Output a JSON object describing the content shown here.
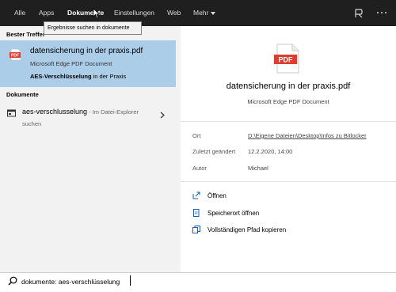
{
  "nav": {
    "tabs": [
      {
        "label": "Alle"
      },
      {
        "label": "Apps"
      },
      {
        "label": "Dokumente"
      },
      {
        "label": "Einstellungen"
      },
      {
        "label": "Web"
      },
      {
        "label": "Mehr"
      }
    ],
    "active_tab": "Dokumente",
    "icons": [
      "feedback-icon",
      "more-options-icon"
    ]
  },
  "tooltip": {
    "text": "Ergebnisse suchen in dokumente"
  },
  "left": {
    "best_match_label": "Bester Treffer",
    "best_match": {
      "title": "datensicherung in der praxis.pdf",
      "type": "Microsoft Edge PDF Document",
      "match_bold": "AES-Verschlüsselung",
      "match_rest": " in der Praxis",
      "icon": "pdf-icon"
    },
    "documents_label": "Dokumente",
    "documents": [
      {
        "title": "aes-verschlusselung",
        "hint": " - Im Datei-Explorer",
        "hint2": "suchen",
        "icon": "file-explorer-icon"
      }
    ]
  },
  "preview": {
    "title": "datensicherung in der praxis.pdf",
    "type": "Microsoft Edge PDF Document",
    "meta": [
      {
        "key": "Ort",
        "value": "D:\\Eigene Dateien\\Desktop\\Infos zu Bitlocker"
      },
      {
        "key": "Zuletzt geändert",
        "value": "12.2.2020, 14:00"
      },
      {
        "key": "Autor",
        "value": "Michael"
      }
    ],
    "actions": [
      {
        "label": "Öffnen",
        "icon": "open-icon"
      },
      {
        "label": "Speicherort öffnen",
        "icon": "folder-location-icon"
      },
      {
        "label": "Vollständigen Pfad kopieren",
        "icon": "copy-path-icon"
      }
    ]
  },
  "search": {
    "value": "dokumente: aes-verschlüsselung"
  },
  "colors": {
    "topbar": "#1f1f1f",
    "selected": "#abcde8",
    "pdf_red": "#e23a2f"
  }
}
